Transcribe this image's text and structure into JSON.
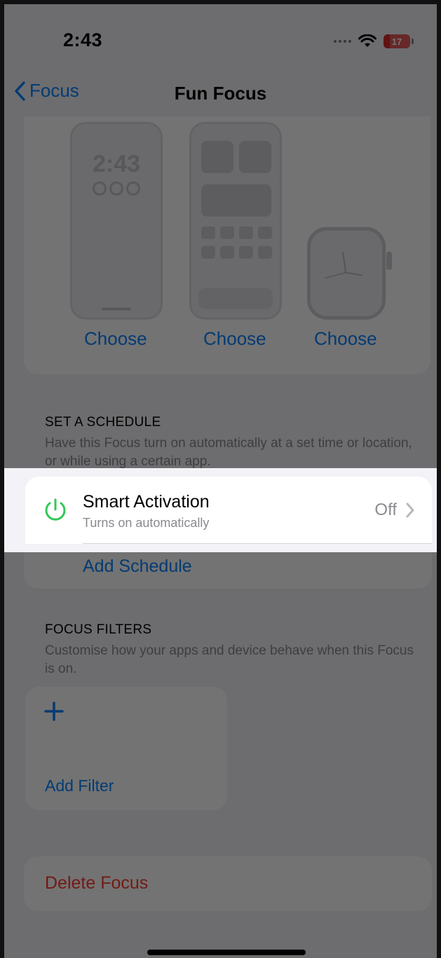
{
  "status_bar": {
    "time": "2:43",
    "battery_level": "17",
    "icons": [
      "cellular-dots-icon",
      "wifi-icon",
      "battery-icon"
    ]
  },
  "nav": {
    "back_label": "Focus",
    "title": "Fun Focus"
  },
  "customise": {
    "lock_screen_time": "2:43",
    "choose_labels": [
      "Choose",
      "Choose",
      "Choose"
    ]
  },
  "schedule": {
    "header": "SET A SCHEDULE",
    "footer": "Have this Focus turn on automatically at a set time or location, or while using a certain app.",
    "smart_activation": {
      "title": "Smart Activation",
      "subtitle": "Turns on automatically",
      "value": "Off",
      "icon": "power-icon",
      "accent": "#34c759"
    },
    "add_label": "Add Schedule"
  },
  "filters": {
    "header": "FOCUS FILTERS",
    "footer": "Customise how your apps and device behave when this Focus is on.",
    "add_label": "Add Filter"
  },
  "delete": {
    "label": "Delete Focus",
    "color": "#ff3b30"
  },
  "colors": {
    "link": "#0a84ff",
    "background": "#f2f2f7"
  }
}
